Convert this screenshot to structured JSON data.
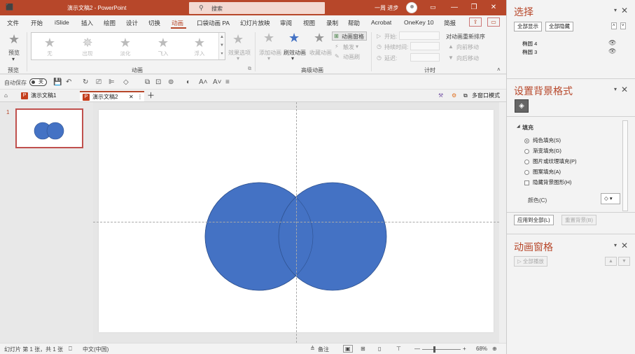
{
  "title": {
    "doc_title": "演示文稿2 - PowerPoint",
    "search_placeholder": "搜索",
    "user_name": "一周 进步",
    "minimize": "—",
    "restore": "❐",
    "close": "✕"
  },
  "ribbon_tabs": [
    "文件",
    "开始",
    "iSlide",
    "插入",
    "绘图",
    "设计",
    "切换",
    "动画",
    "口袋动画 PA",
    "幻灯片放映",
    "审阅",
    "视图",
    "录制",
    "帮助",
    "Acrobat",
    "OneKey 10",
    "简报"
  ],
  "active_tab": "动画",
  "ribbon": {
    "preview_label": "预览",
    "preview_group": "预览",
    "animation_items": [
      "无",
      "出现",
      "淡化",
      "飞入",
      "浮入"
    ],
    "effect_options": "效果选项",
    "animation_group": "动画",
    "add_animation": "添加动画",
    "painter": "刷效动画",
    "collect": "收藏动画",
    "anim_pane": "动画窗格",
    "trigger": "触发",
    "anim_brush": "动画刷",
    "advanced_group": "高级动画",
    "start_label": "开始:",
    "duration_label": "持续时间:",
    "delay_label": "延迟:",
    "reorder_title": "对动画重新排序",
    "move_earlier": "向前移动",
    "move_later": "向后移动",
    "timing_group": "计时"
  },
  "qat": {
    "autosave": "自动保存",
    "autosave_state": "关"
  },
  "doc_tabs": [
    {
      "label": "演示文稿1",
      "active": false
    },
    {
      "label": "演示文稿2",
      "active": true
    }
  ],
  "doc_tabs_right": {
    "multi_window": "多窗口模式"
  },
  "slides": {
    "number": "1"
  },
  "status": {
    "slide_info": "幻灯片 第 1 张，共 1 张",
    "language": "中文(中国)",
    "notes": "备注",
    "zoom": "68%"
  },
  "selection_pane": {
    "title": "选择",
    "show_all": "全部显示",
    "hide_all": "全部隐藏",
    "items": [
      "椭圆 4",
      "椭圆 3"
    ]
  },
  "format_pane": {
    "title": "设置背景格式",
    "section": "填充",
    "options": [
      "纯色填充(S)",
      "渐变填充(G)",
      "图片或纹理填充(P)",
      "图案填充(A)"
    ],
    "selected_index": 0,
    "hide_bg": "隐藏背景图形(H)",
    "color_label": "颜色(C)",
    "apply_all": "应用到全部(L)",
    "reset_bg": "重置背景(B)"
  },
  "anim_pane": {
    "title": "动画窗格",
    "play_all": "全部播放"
  },
  "colors": {
    "accent": "#b7472a",
    "shape_fill": "#4472c4",
    "shape_stroke": "#2f528f"
  }
}
